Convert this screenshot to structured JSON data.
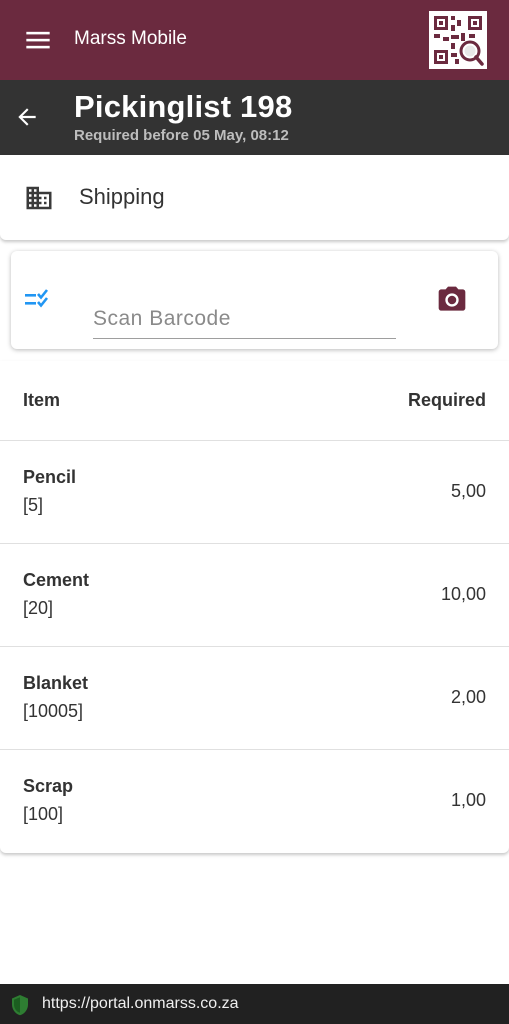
{
  "app": {
    "title": "Marss Mobile",
    "brand_color": "#6b2a3f",
    "menu_icon": "menu-icon",
    "qr_icon": "qr-search-icon"
  },
  "header": {
    "title": "Pickinglist 198",
    "subtitle": "Required before 05 May, 08:12",
    "back_icon": "arrow-left-icon"
  },
  "location": {
    "icon": "building-icon",
    "label": "Shipping"
  },
  "scan": {
    "icon": "checklist-icon",
    "placeholder": "Scan Barcode",
    "value": "",
    "camera_icon": "camera-icon",
    "accent_color": "#2196f3"
  },
  "table": {
    "headers": {
      "item": "Item",
      "required": "Required"
    },
    "rows": [
      {
        "name": "Pencil",
        "code": "[5]",
        "required": "5,00"
      },
      {
        "name": "Cement",
        "code": "[20]",
        "required": "10,00"
      },
      {
        "name": "Blanket",
        "code": "[10005]",
        "required": "2,00"
      },
      {
        "name": "Scrap",
        "code": "[100]",
        "required": "1,00"
      }
    ]
  },
  "browser": {
    "url": "https://portal.onmarss.co.za",
    "secure_icon": "shield-icon",
    "secure_color": "#2e7d32"
  }
}
